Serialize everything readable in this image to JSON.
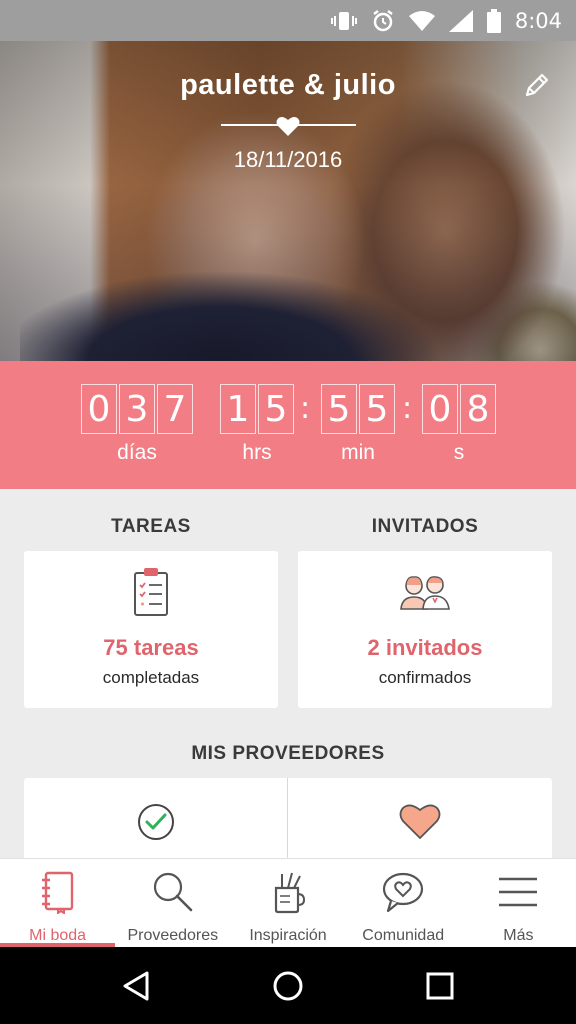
{
  "status_bar": {
    "time": "8:04"
  },
  "hero": {
    "couple_names": "paulette & julio",
    "wedding_date": "18/11/2016"
  },
  "countdown": {
    "days": [
      "0",
      "3",
      "7"
    ],
    "hours": [
      "1",
      "5"
    ],
    "minutes": [
      "5",
      "5"
    ],
    "seconds": [
      "0",
      "8"
    ],
    "separator": ":",
    "labels": {
      "days": "días",
      "hours": "hrs",
      "minutes": "min",
      "seconds": "s"
    }
  },
  "tasks": {
    "title": "TAREAS",
    "value": "75 tareas",
    "sub": "completadas"
  },
  "guests": {
    "title": "INVITADOS",
    "value": "2 invitados",
    "sub": "confirmados"
  },
  "providers": {
    "title": "MIS PROVEEDORES"
  },
  "bottom_nav": {
    "items": [
      {
        "label": "Mi boda",
        "icon": "notebook-icon",
        "active": true
      },
      {
        "label": "Proveedores",
        "icon": "search-icon",
        "active": false
      },
      {
        "label": "Inspiración",
        "icon": "pencil-cup-icon",
        "active": false
      },
      {
        "label": "Comunidad",
        "icon": "chat-heart-icon",
        "active": false
      },
      {
        "label": "Más",
        "icon": "menu-icon",
        "active": false
      }
    ]
  },
  "colors": {
    "accent": "#e0646c",
    "countdown_bg": "#f27d85",
    "status_bar": "#9e9e9e",
    "background": "#ececec"
  }
}
